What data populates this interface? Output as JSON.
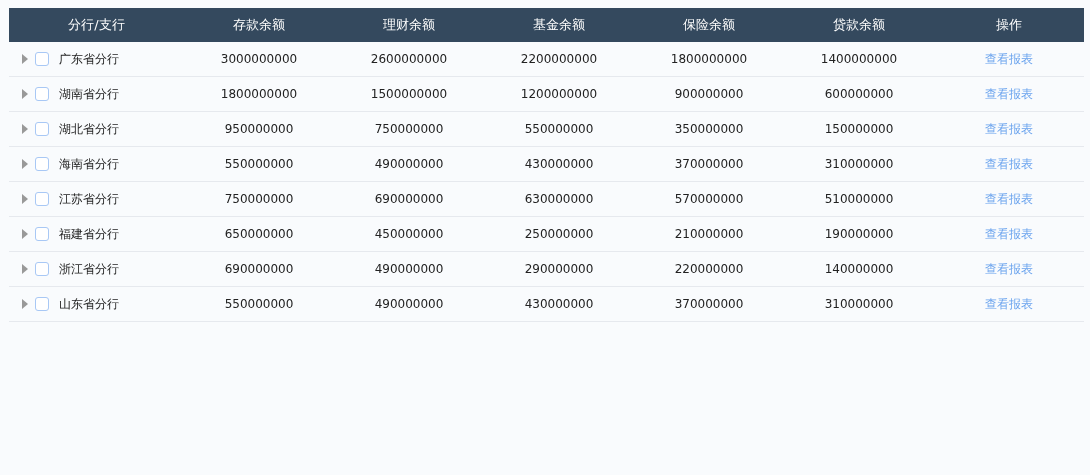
{
  "table": {
    "columns": [
      "分行/支行",
      "存款余额",
      "理财余额",
      "基金余额",
      "保险余额",
      "贷款余额",
      "操作"
    ],
    "rows": [
      {
        "name": "广东省分行",
        "expanded": false,
        "checked": false,
        "values": [
          "3000000000",
          "2600000000",
          "2200000000",
          "1800000000",
          "1400000000"
        ],
        "action": "查看报表"
      },
      {
        "name": "湖南省分行",
        "expanded": false,
        "checked": false,
        "values": [
          "1800000000",
          "1500000000",
          "1200000000",
          "900000000",
          "600000000"
        ],
        "action": "查看报表"
      },
      {
        "name": "湖北省分行",
        "expanded": false,
        "checked": false,
        "values": [
          "950000000",
          "750000000",
          "550000000",
          "350000000",
          "150000000"
        ],
        "action": "查看报表"
      },
      {
        "name": "海南省分行",
        "expanded": false,
        "checked": false,
        "values": [
          "550000000",
          "490000000",
          "430000000",
          "370000000",
          "310000000"
        ],
        "action": "查看报表"
      },
      {
        "name": "江苏省分行",
        "expanded": false,
        "checked": false,
        "values": [
          "750000000",
          "690000000",
          "630000000",
          "570000000",
          "510000000"
        ],
        "action": "查看报表"
      },
      {
        "name": "福建省分行",
        "expanded": false,
        "checked": false,
        "values": [
          "650000000",
          "450000000",
          "250000000",
          "210000000",
          "190000000"
        ],
        "action": "查看报表"
      },
      {
        "name": "浙江省分行",
        "expanded": false,
        "checked": false,
        "values": [
          "690000000",
          "490000000",
          "290000000",
          "220000000",
          "140000000"
        ],
        "action": "查看报表"
      },
      {
        "name": "山东省分行",
        "expanded": false,
        "checked": false,
        "values": [
          "550000000",
          "490000000",
          "430000000",
          "370000000",
          "310000000"
        ],
        "action": "查看报表"
      }
    ]
  }
}
